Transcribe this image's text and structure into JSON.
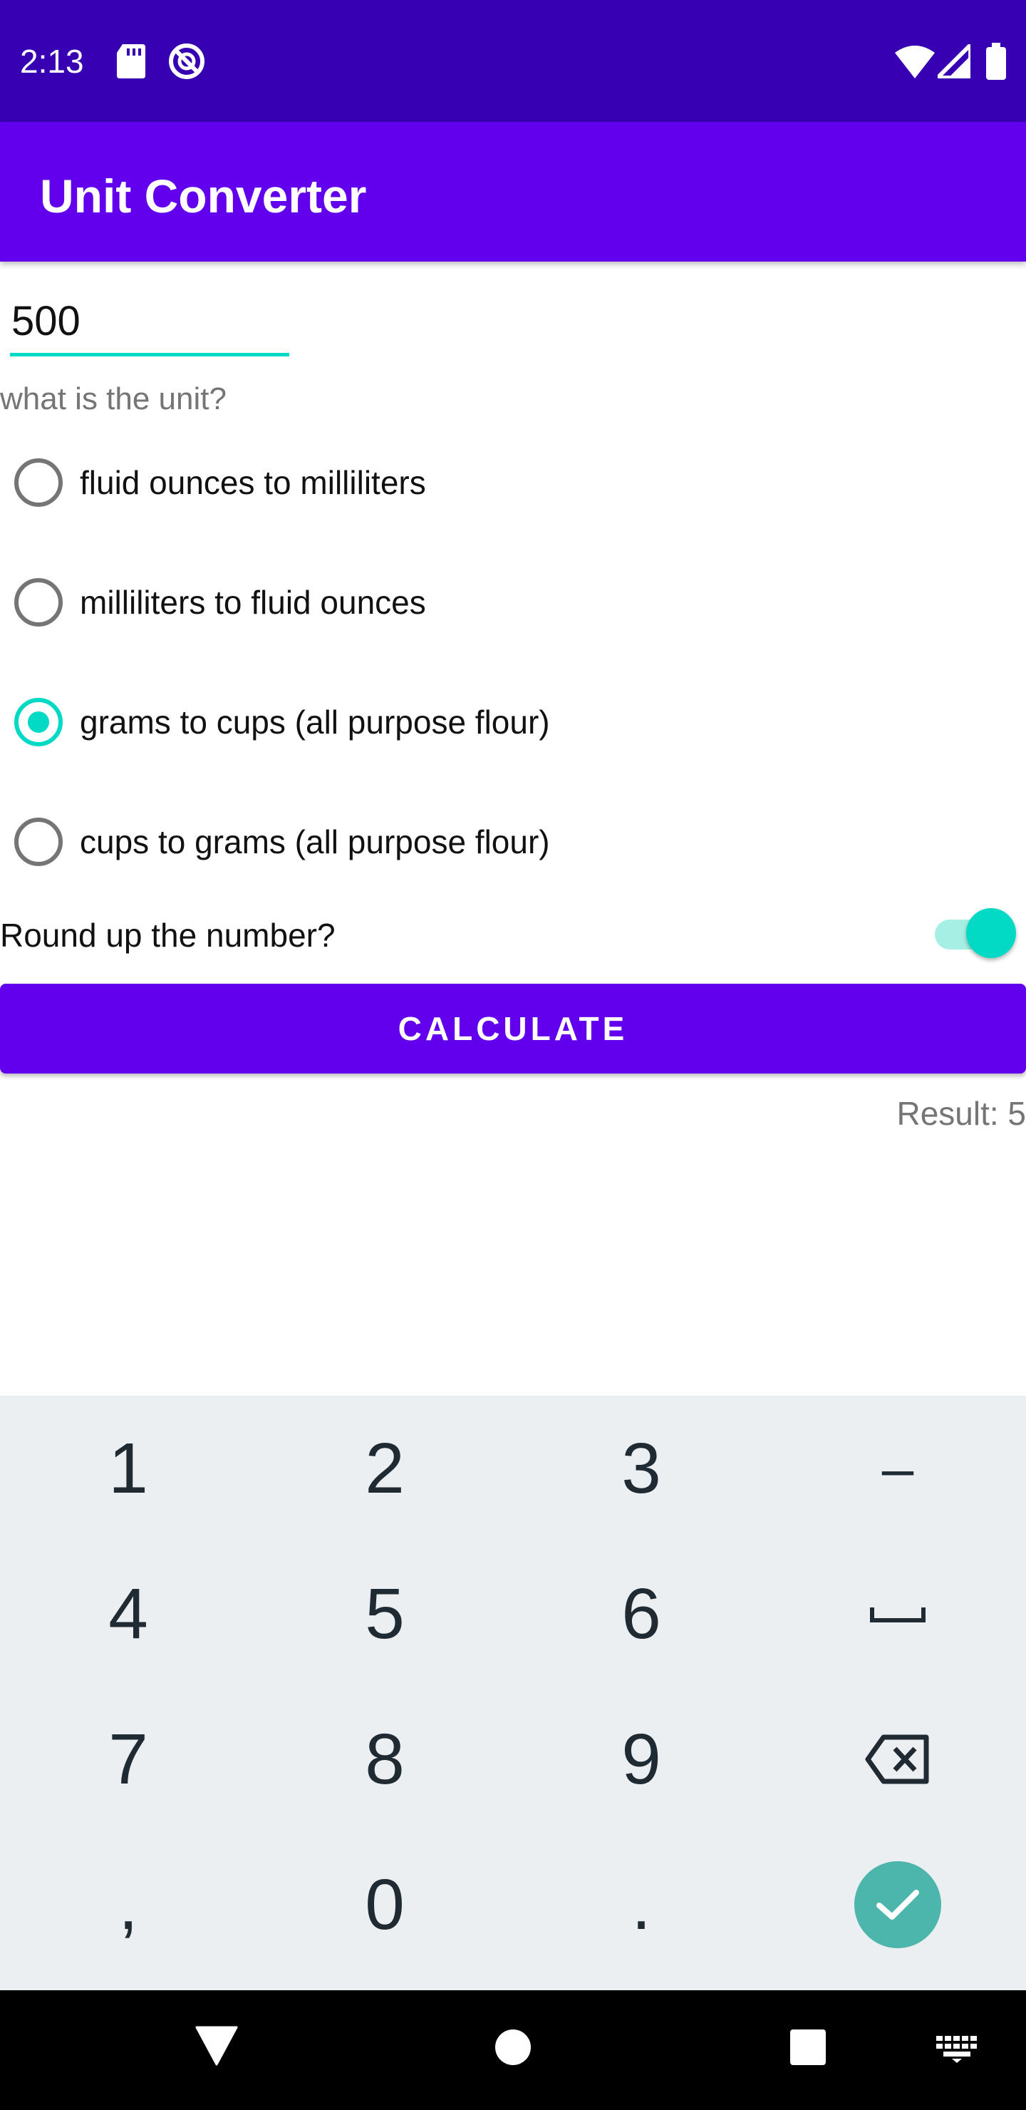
{
  "status_bar": {
    "time": "2:13",
    "icons": [
      "sd-card-icon",
      "do-not-disturb-icon",
      "wifi-icon",
      "cell-signal-icon",
      "battery-icon"
    ]
  },
  "app_bar": {
    "title": "Unit Converter"
  },
  "input": {
    "value": "500"
  },
  "unit_prompt": "what is the unit?",
  "options": [
    {
      "label": "fluid ounces to milliliters",
      "checked": false
    },
    {
      "label": "milliliters to fluid ounces",
      "checked": false
    },
    {
      "label": "grams to cups (all purpose flour)",
      "checked": true
    },
    {
      "label": "cups to grams (all purpose flour)",
      "checked": false
    }
  ],
  "round": {
    "label": "Round up the number?",
    "enabled": true
  },
  "calculate_label": "CALCULATE",
  "result_text": "Result: 5",
  "keyboard": {
    "keys": [
      "1",
      "2",
      "3",
      "–",
      "4",
      "5",
      "6",
      "␣",
      "7",
      "8",
      "9",
      "⌫",
      ",",
      "0",
      ".",
      "✓"
    ]
  },
  "nav_bar": {
    "icons": [
      "back-icon",
      "home-icon",
      "recents-icon",
      "keyboard-switch-icon"
    ]
  },
  "colors": {
    "status_bar": "#3700b3",
    "primary": "#6200ee",
    "accent": "#03dac5",
    "keyboard_bg": "#eceff1",
    "done_key": "#4db6ac",
    "text_secondary": "#757575"
  }
}
